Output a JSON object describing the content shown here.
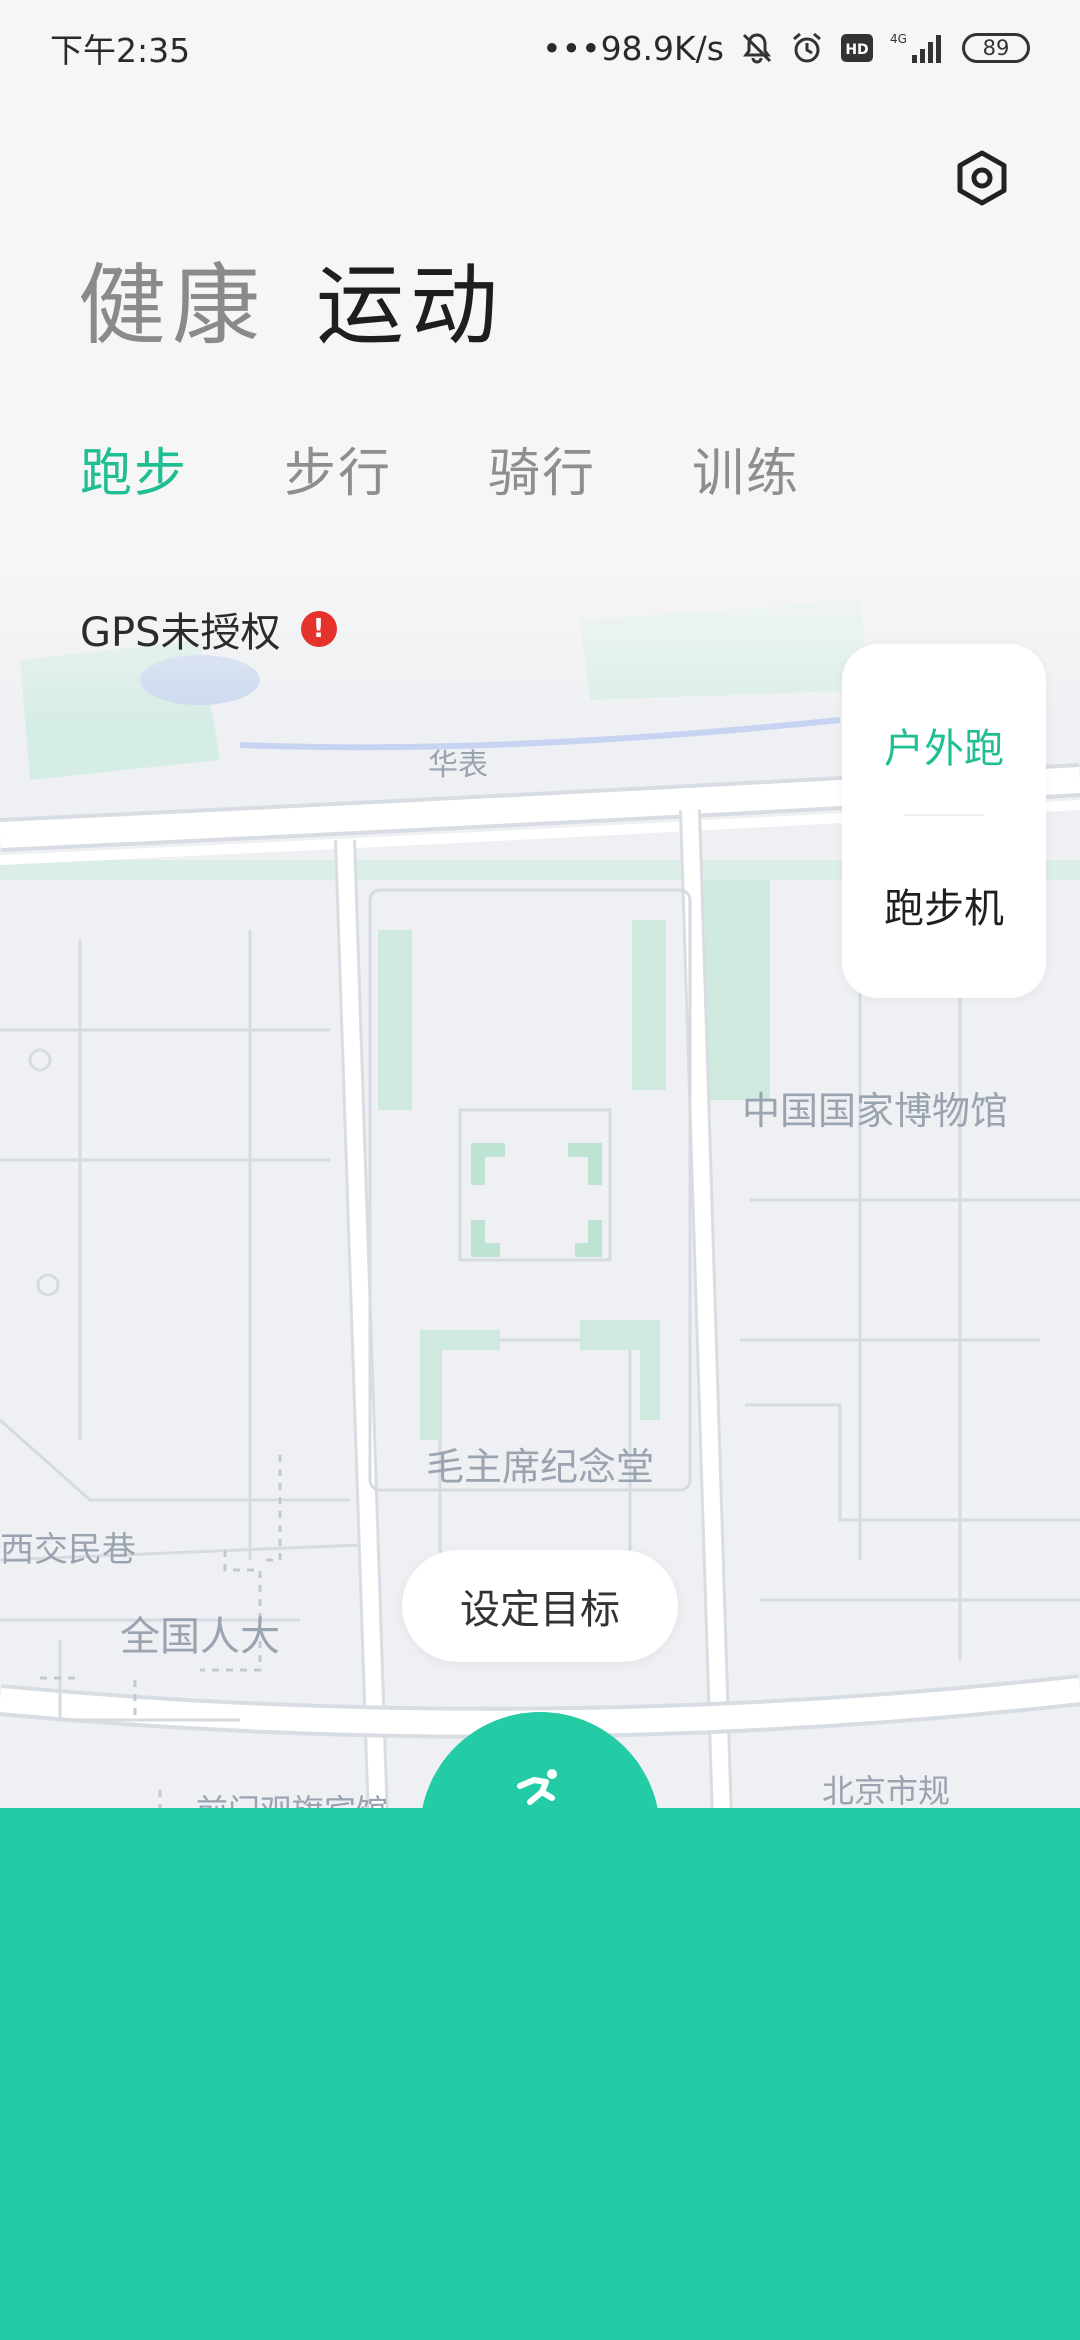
{
  "status_bar": {
    "time": "下午2:35",
    "network_speed": "•••98.9K/s",
    "hd_badge": "HD",
    "signal_type": "4G",
    "battery": "89"
  },
  "header": {
    "settings_icon": "settings-hexagon-icon",
    "section_tabs": [
      {
        "label": "健康",
        "active": false
      },
      {
        "label": "运动",
        "active": true
      }
    ],
    "sport_tabs": [
      {
        "label": "跑步",
        "active": true
      },
      {
        "label": "步行",
        "active": false
      },
      {
        "label": "骑行",
        "active": false
      },
      {
        "label": "训练",
        "active": false
      }
    ]
  },
  "map": {
    "gps_status": "GPS未授权",
    "gps_warning_icon": "!",
    "labels": [
      "华表",
      "中国国家博物馆",
      "毛主席纪念堂",
      "西交民巷",
      "全国人大",
      "前门观旗宾馆",
      "北京市规"
    ]
  },
  "run_modes": {
    "outdoor": "户外跑",
    "treadmill": "跑步机"
  },
  "goal_button": "设定目标",
  "start_button_icon": "running-person-icon",
  "colors": {
    "accent": "#1fbe93",
    "panel": "#23cca4",
    "warning": "#e5322d"
  }
}
